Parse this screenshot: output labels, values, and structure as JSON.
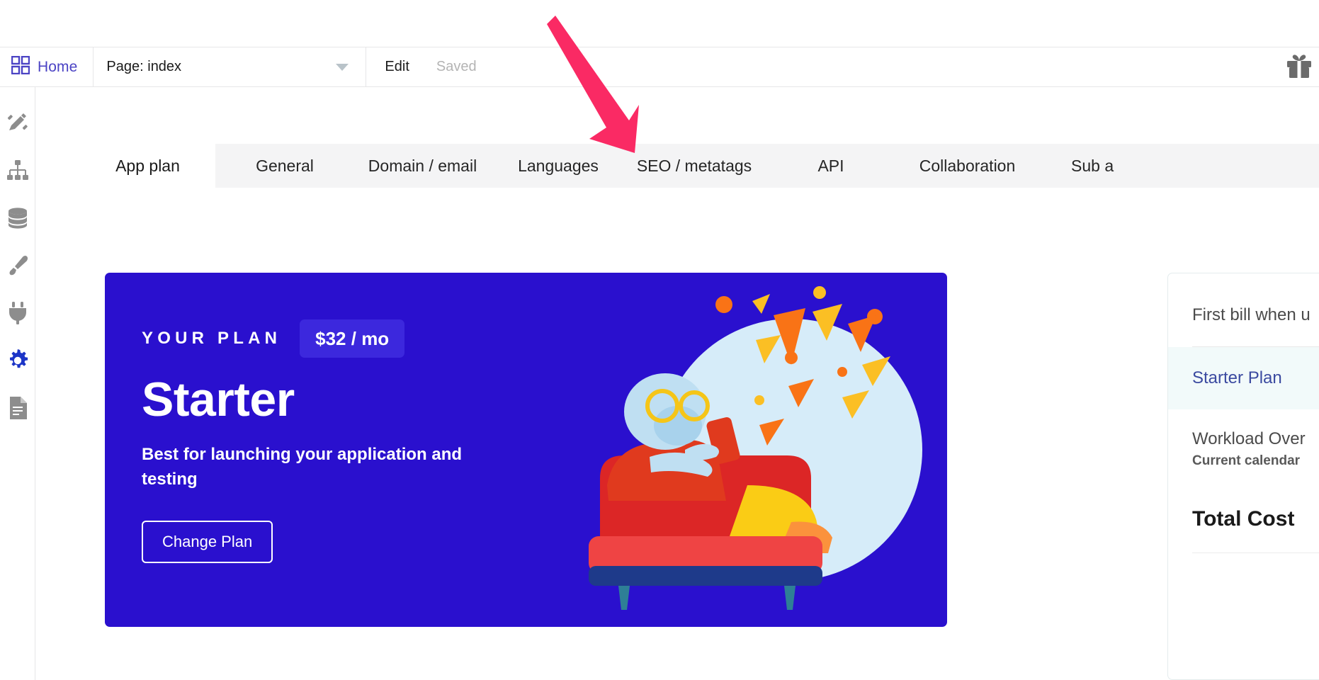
{
  "toolbar": {
    "home_label": "Home",
    "home_icon": "grid-icon",
    "page_selector_label": "Page: index",
    "page_selector_caret": "chevron-down-icon",
    "edit_label": "Edit",
    "saved_label": "Saved",
    "gift_icon": "gift-icon"
  },
  "rail": {
    "items": [
      {
        "icon": "design-tools-icon",
        "active": false
      },
      {
        "icon": "sitemap-icon",
        "active": false
      },
      {
        "icon": "database-icon",
        "active": false
      },
      {
        "icon": "paintbrush-icon",
        "active": false
      },
      {
        "icon": "plug-icon",
        "active": false
      },
      {
        "icon": "gear-icon",
        "active": true
      },
      {
        "icon": "document-icon",
        "active": false
      }
    ]
  },
  "tabs": [
    {
      "label": "App plan",
      "active": true
    },
    {
      "label": "General",
      "active": false
    },
    {
      "label": "Domain / email",
      "active": false
    },
    {
      "label": "Languages",
      "active": false
    },
    {
      "label": "SEO / metatags",
      "active": false
    },
    {
      "label": "API",
      "active": false
    },
    {
      "label": "Collaboration",
      "active": false
    },
    {
      "label": "Sub a",
      "active": false
    }
  ],
  "plan_card": {
    "eyebrow": "YOUR PLAN",
    "price": "$32 / mo",
    "title": "Starter",
    "description": "Best for launching your application and testing",
    "button_label": "Change Plan",
    "bg_color": "#2a10ce",
    "badge_color": "#3c28dd",
    "illustration": "monkey-on-sofa-with-phone-illustration"
  },
  "side_panel": {
    "first_bill_label": "First bill when u",
    "plan_row_label": "Starter Plan",
    "workload_title": "Workload Over",
    "workload_sub": "Current calendar",
    "total_cost_label": "Total Cost",
    "highlight_color": "#f2fafa",
    "link_color": "#3b4aa0"
  },
  "annotation": {
    "arrow_icon": "pink-arrow-icon",
    "arrow_color": "#fa2a64"
  }
}
